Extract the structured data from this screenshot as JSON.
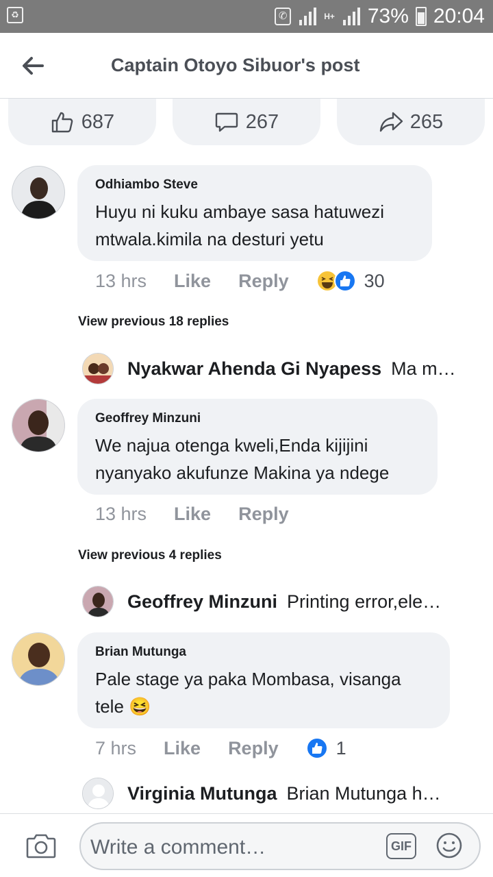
{
  "status_bar": {
    "battery": "73%",
    "time": "20:04",
    "network": "H+"
  },
  "header": {
    "title": "Captain Otoyo Sibuor's post"
  },
  "stats": {
    "likes": "687",
    "comments": "267",
    "shares": "265"
  },
  "comments": [
    {
      "author": "Odhiambo Steve",
      "text": "Huyu ni kuku ambaye sasa hatuwezi mtwala.kimila na desturi yetu",
      "time": "13 hrs",
      "like": "Like",
      "reply": "Reply",
      "reactions": [
        "haha-icon",
        "like-icon"
      ],
      "reaction_count": "30",
      "view_previous": "View previous 18 replies",
      "latest_reply": {
        "author": "Nyakwar Ahenda Gi Nyapess",
        "text": "Ma m…"
      }
    },
    {
      "author": "Geoffrey Minzuni",
      "text": "We najua otenga kweli,Enda kijijini nyanyako akufunze Makina ya ndege",
      "time": "13 hrs",
      "like": "Like",
      "reply": "Reply",
      "view_previous": "View previous 4 replies",
      "latest_reply": {
        "author": "Geoffrey Minzuni",
        "text": "Printing error,ele…"
      }
    },
    {
      "author": "Brian Mutunga",
      "text": "Pale stage ya paka Mombasa, visanga tele",
      "emoji": "😆",
      "time": "7 hrs",
      "like": "Like",
      "reply": "Reply",
      "reactions": [
        "like-icon"
      ],
      "reaction_count": "1",
      "latest_reply": {
        "author": "Virginia Mutunga",
        "text": "Brian Mutunga h…"
      }
    }
  ],
  "composer": {
    "placeholder": "Write a comment…",
    "gif_label": "GIF"
  },
  "colors": {
    "accent": "#1877f2",
    "bubble": "#f0f2f5",
    "muted": "#90949c",
    "statusbar": "#7b7b7b"
  }
}
